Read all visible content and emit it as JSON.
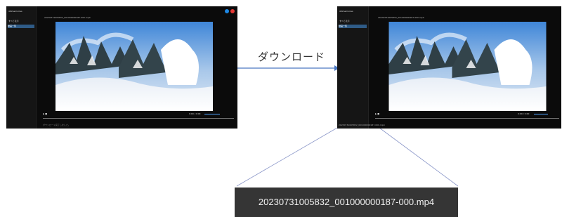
{
  "annotation": {
    "label": "ダウンロード"
  },
  "before_screen": {
    "brand": "iiitimemories",
    "nav_label": "すべて表示",
    "nav_selected": "動画一覧",
    "path": "20230731005832_001000000187-000.mp4",
    "player_time": "0:00 / 0:00",
    "footer": "ダウンロード完了しました。"
  },
  "after_screen": {
    "brand": "iiitimemories",
    "nav_label": "すべて表示",
    "nav_selected": "動画一覧",
    "path": "20230731005832_001000000187-000.mp4",
    "player_time": "0:00 / 0:00",
    "download_file": "20230731005832_001000000187-000.mp4"
  },
  "zoom_box": {
    "filename": "20230731005832_001000000187-000.mp4"
  },
  "colors": {
    "accent": "#4ea3ff",
    "dot_blue": "#1e88e5",
    "dot_red": "#e53935"
  }
}
